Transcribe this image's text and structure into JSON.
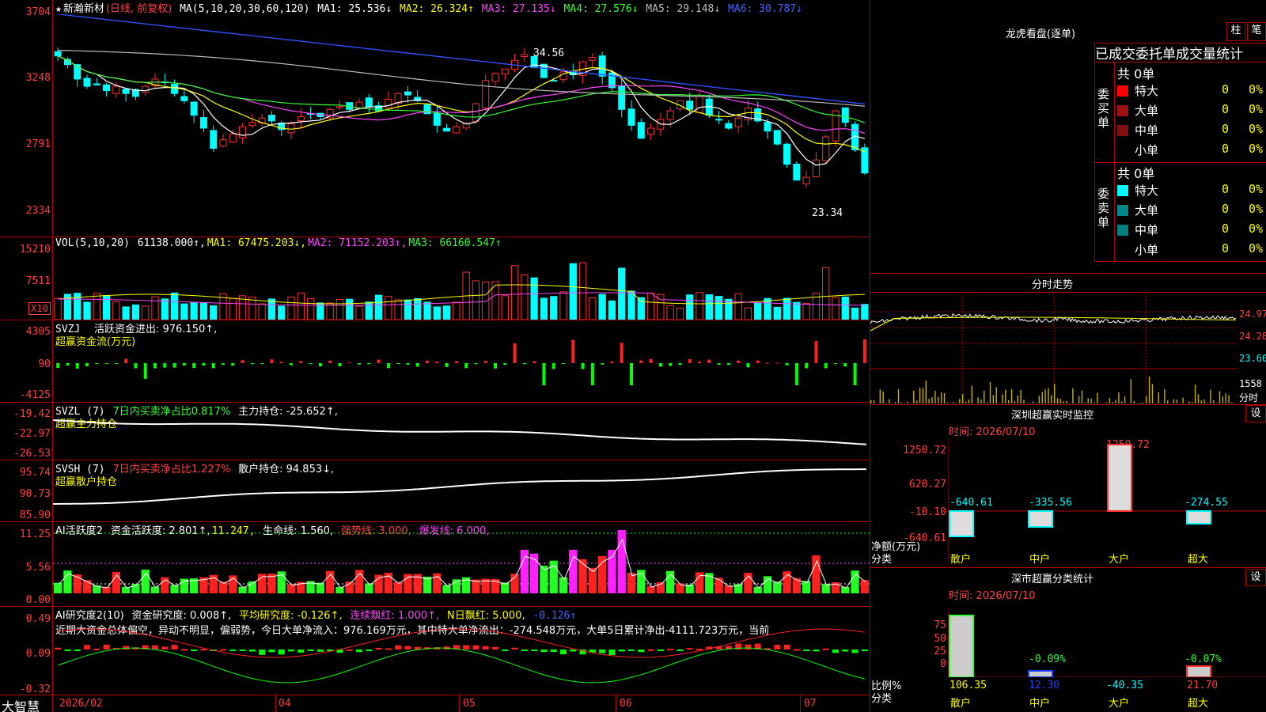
{
  "header": {
    "star": "★",
    "stock": "新瀚新材",
    "period": "(日线, 前复权)",
    "ma_prefix": "MA(5,10,20,30,60,120)",
    "ma": [
      {
        "label": "MA1: 25.536↓",
        "color": "#ffffff"
      },
      {
        "label": "MA2: 26.324↑",
        "color": "#ffff00"
      },
      {
        "label": "MA3: 27.135↓",
        "color": "#ff44ff"
      },
      {
        "label": "MA4: 27.576↓",
        "color": "#33ff33"
      },
      {
        "label": "MA5: 29.148↓",
        "color": "#bbbbbb"
      },
      {
        "label": "MA6: 30.787↓",
        "color": "#4466ff"
      }
    ],
    "high_label": "34.56",
    "low_label": "23.34"
  },
  "price_axis": [
    "3704",
    "3248",
    "2791",
    "2334"
  ],
  "vol": {
    "title": "VOL(5,10,20)",
    "val": "61138.000↑,",
    "ma": [
      {
        "label": "MA1: 67475.203↓,",
        "color": "#ffff00"
      },
      {
        "label": "MA2: 71152.203↑,",
        "color": "#ff44ff"
      },
      {
        "label": "MA3: 66160.547↑",
        "color": "#33ff33"
      }
    ],
    "axis": [
      "15210",
      "7511"
    ],
    "unit": "X10"
  },
  "svzj": {
    "title": "SVZJ",
    "t1": "活跃资金进出: 976.150↑,",
    "t2": "超赢资金流(万元)",
    "axis": [
      "4305",
      "90",
      "-4125"
    ]
  },
  "svzl": {
    "title": "SVZL (7)",
    "t1": "7日内买卖净占比0.817%",
    "t2": "主力持仓: -25.652↑,",
    "t3": "超赢主力持仓",
    "axis": [
      "-19.42",
      "-22.97",
      "-26.53"
    ]
  },
  "svsh": {
    "title": "SVSH (7)",
    "t1": "7日内买卖净占比1.227%",
    "t2": "散户持仓: 94.853↓,",
    "t3": "超赢散户持仓",
    "axis": [
      "95.74",
      "90.73",
      "85.90"
    ]
  },
  "aihy": {
    "title": "AI活跃度2",
    "t1": "资金活跃度: 2.801↑,",
    "t2": "11.247,",
    "t3": "生命线: 1.560,",
    "t4": "强势线: 3.000,",
    "t5": "爆发线: 6.000,",
    "axis": [
      "11.25",
      "5.56",
      "0.00"
    ]
  },
  "aiyj": {
    "title": "AI研究度2(10)",
    "t1": "资金研究度: 0.008↑,",
    "t2": "平均研究度: -0.126↑,",
    "t3": "连续飘红: 1.000↑,",
    "t4": "N日飘红: 5.000,",
    "t5": "-0.126↑",
    "comment": "近期大资金总体偏空，异动不明显，偏弱势，今日大单净流入：976.169万元，其中特大单净流出：-274.548万元，大单5日累计净出-4111.723万元，当前",
    "axis": [
      "0.49",
      "0.09",
      "-0.32"
    ]
  },
  "dates": [
    "2026/02",
    "04",
    "05",
    "06",
    "07"
  ],
  "brand": "大智慧",
  "dragon": {
    "title": "龙虎看盘(逐单)",
    "btn1": "柱",
    "btn2": "笔",
    "head": "已成交委托单成交量统计",
    "buy_label": "委买单",
    "sell_label": "委卖单",
    "buy_total": "共 0单",
    "sell_total": "共 0单",
    "buy": [
      {
        "name": "特大",
        "n": "0",
        "p": "0%",
        "c": "#ff0000"
      },
      {
        "name": "大单",
        "n": "0",
        "p": "0%",
        "c": "#a01010"
      },
      {
        "name": "中单",
        "n": "0",
        "p": "0%",
        "c": "#801010"
      },
      {
        "name": "小单",
        "n": "0",
        "p": "0%",
        "c": "#000000"
      }
    ],
    "sell": [
      {
        "name": "特大",
        "n": "0",
        "p": "0%",
        "c": "#00ffff"
      },
      {
        "name": "大单",
        "n": "0",
        "p": "0%",
        "c": "#008888"
      },
      {
        "name": "中单",
        "n": "0",
        "p": "0%",
        "c": "#008080"
      },
      {
        "name": "小单",
        "n": "0",
        "p": "0%",
        "c": "#000000"
      }
    ]
  },
  "intraday": {
    "title": "分时走势",
    "axis": [
      "24.97",
      "24.28",
      "23.60"
    ],
    "vol": "1558",
    "unit": "分时"
  },
  "monitor": {
    "title": "深圳超赢实时监控",
    "btn": "设",
    "time": "时间: 2026/07/10",
    "axis": [
      "1250.72",
      "620.27",
      "-10.10",
      "-640.61"
    ],
    "vals": [
      "-640.61",
      "-335.56",
      "1250.72",
      "-274.55"
    ],
    "ylabel": "净额(万元)",
    "xlabel": "分类",
    "cats": [
      "散户",
      "中户",
      "大户",
      "超大"
    ]
  },
  "classify": {
    "title": "深市超赢分类统计",
    "btn": "设",
    "time": "时间: 2026/07/10",
    "axis": [
      "75",
      "50",
      "25",
      "0"
    ],
    "pcts": [
      "-0.09%",
      "-0.07%"
    ],
    "vals": [
      "106.35",
      "12.30",
      "-40.35",
      "21.70"
    ],
    "ylabel": "比例%",
    "xlabel": "分类",
    "cats": [
      "散户",
      "中户",
      "大户",
      "超大"
    ]
  }
}
